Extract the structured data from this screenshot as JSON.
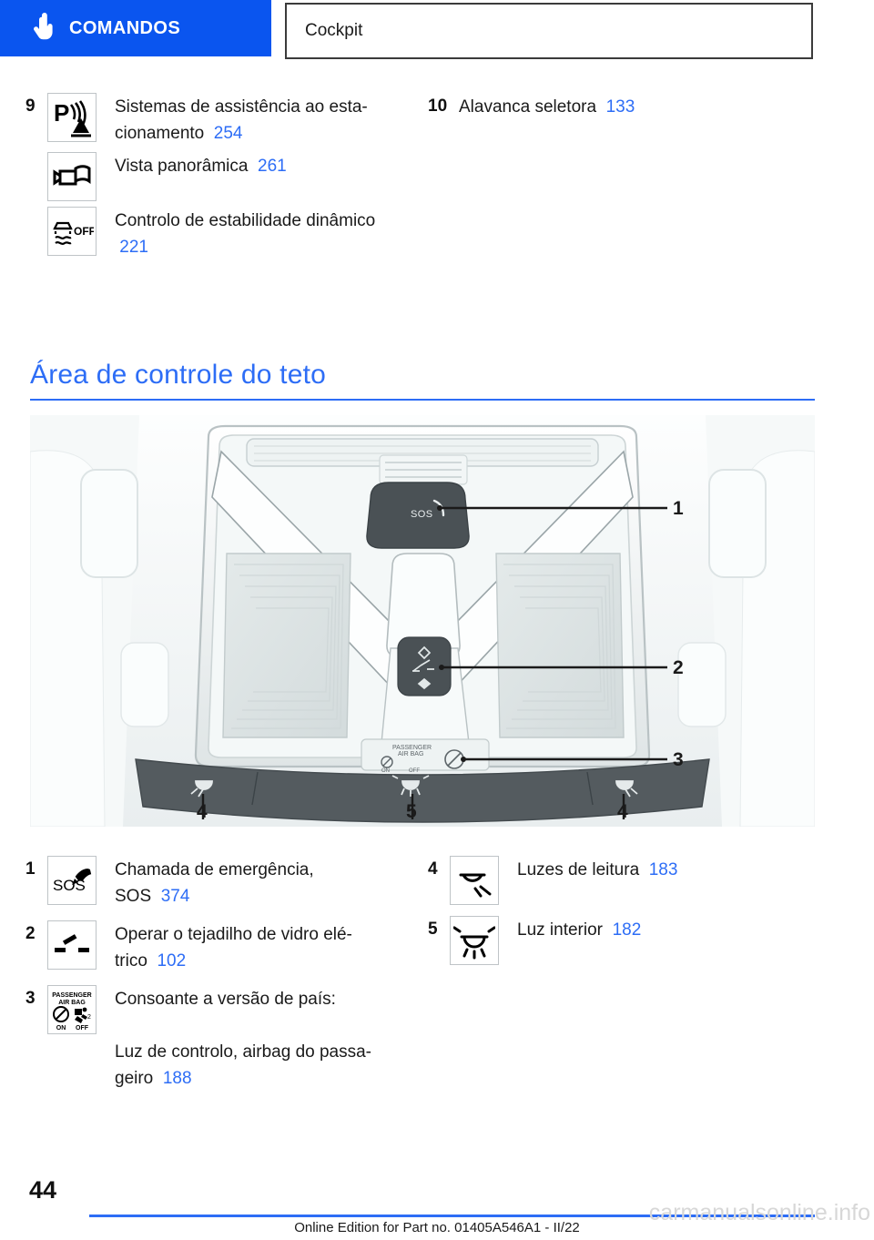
{
  "header": {
    "chapter_tab": {
      "label": "COMANDOS",
      "icon": "hand-pointer-icon",
      "bg_color": "#0a55ef",
      "text_color": "#ffffff"
    },
    "section_tab": {
      "label": "Cockpit"
    }
  },
  "top_legend": {
    "left_column": [
      {
        "number": "9",
        "icon": "parking-assistant-icon",
        "text": "Sistemas de assistência ao esta-cionamento",
        "text_line1": "Sistemas de assistência ao esta-",
        "text_line2": "cionamento",
        "page": "254"
      },
      {
        "number": "",
        "icon": "surround-view-camera-icon",
        "text_line1": "Vista panorâmica",
        "text_line2": "",
        "page": "261"
      },
      {
        "number": "",
        "icon": "dsc-off-icon",
        "text_line1": "Controlo de estabilidade dinâmico",
        "text_line2": "",
        "page": "221"
      }
    ],
    "right_column": [
      {
        "number": "10",
        "icon": "",
        "text_line1": "Alavanca seletora",
        "page": "133"
      }
    ]
  },
  "section": {
    "title": "Área de controle do teto",
    "accent_color": "#2d6df6"
  },
  "illustration": {
    "name": "roof-control-area-diagram",
    "callouts": [
      "1",
      "2",
      "3",
      "4",
      "5",
      "4"
    ]
  },
  "bottom_legend": {
    "left_column": [
      {
        "number": "1",
        "icon": "sos-emergency-call-icon",
        "text_line1": "Chamada de emergência,",
        "text_line2": "SOS",
        "page": "374"
      },
      {
        "number": "2",
        "icon": "glass-sunroof-icon",
        "text_line1": "Operar o tejadilho de vidro elé-",
        "text_line2": "trico",
        "page": "102"
      },
      {
        "number": "3",
        "icon": "passenger-airbag-indicator-icon",
        "text_line0": "Consoante a versão de país:",
        "text_line1": "Luz de controlo, airbag do passa-",
        "text_line2": "geiro",
        "page": "188"
      }
    ],
    "right_column": [
      {
        "number": "4",
        "icon": "reading-light-icon",
        "text_line1": "Luzes de leitura",
        "page": "183"
      },
      {
        "number": "5",
        "icon": "interior-light-icon",
        "text_line1": "Luz interior",
        "page": "182"
      }
    ]
  },
  "footer": {
    "page_number": "44",
    "note": "Online Edition for Part no. 01405A546A1 - II/22",
    "watermark": "carmanualsonline.info"
  }
}
